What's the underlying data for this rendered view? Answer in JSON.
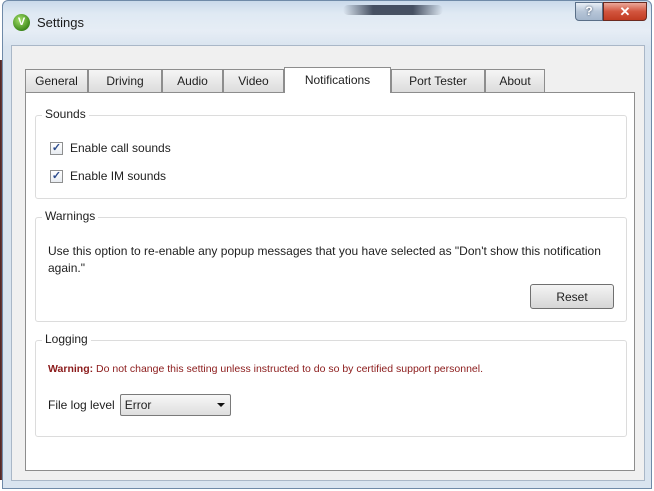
{
  "window": {
    "title": "Settings",
    "app_icon_glyph": "V",
    "help_glyph": "?",
    "close_glyph": "✕"
  },
  "tabs": [
    {
      "label": "General",
      "active": false
    },
    {
      "label": "Driving",
      "active": false
    },
    {
      "label": "Audio",
      "active": false
    },
    {
      "label": "Video",
      "active": false
    },
    {
      "label": "Notifications",
      "active": true
    },
    {
      "label": "Port Tester",
      "active": false
    },
    {
      "label": "About",
      "active": false
    }
  ],
  "sounds": {
    "title": "Sounds",
    "items": [
      {
        "label": "Enable call sounds",
        "checked": true
      },
      {
        "label": "Enable IM sounds",
        "checked": true
      }
    ],
    "check_glyph": "✓"
  },
  "warnings": {
    "title": "Warnings",
    "description": "Use this option to re-enable any popup messages that you have selected as \"Don't show this notification again.\"",
    "reset_label": "Reset"
  },
  "logging": {
    "title": "Logging",
    "warning_prefix": "Warning:",
    "warning_text": " Do not change this setting unless instructed to do so by certified support personnel.",
    "file_log_label": "File log level",
    "file_log_value": "Error"
  },
  "colors": {
    "warning_red": "#8b1a1a",
    "close_red": "#c13b22",
    "frame_blue": "#c9d9ea"
  },
  "icons": {
    "app": "viewer-logo-icon",
    "help": "help-icon",
    "close": "close-icon",
    "check": "checkmark-icon",
    "dropdown": "chevron-down-icon"
  }
}
